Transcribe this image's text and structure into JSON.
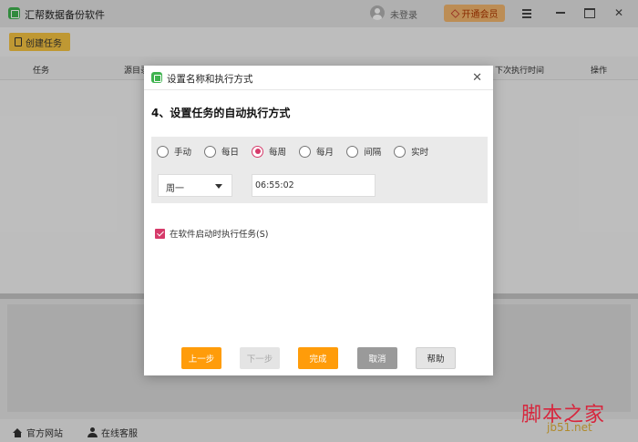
{
  "app": {
    "title": "汇帮数据备份软件",
    "login_label": "未登录",
    "vip_label": "开通会员"
  },
  "toolbar": {
    "create_task_label": "创建任务"
  },
  "table": {
    "headers": [
      "任务",
      "源目录",
      "下次执行时间",
      "操作"
    ]
  },
  "statusbar": {
    "website_label": "官方网站",
    "support_label": "在线客服"
  },
  "watermark": {
    "main": "脚本之家",
    "sub": "jb51.net"
  },
  "dialog": {
    "title": "设置名称和执行方式",
    "step_title": "4、设置任务的自动执行方式",
    "frequency_options": [
      {
        "label": "手动",
        "checked": false
      },
      {
        "label": "每日",
        "checked": false
      },
      {
        "label": "每周",
        "checked": true
      },
      {
        "label": "每月",
        "checked": false
      },
      {
        "label": "间隔",
        "checked": false
      },
      {
        "label": "实时",
        "checked": false
      }
    ],
    "weekday_value": "周一",
    "time_value": "06:55:02",
    "run_on_startup_label": "在软件启动时执行任务(S)",
    "run_on_startup_checked": true,
    "buttons": {
      "prev": "上一步",
      "next": "下一步",
      "finish": "完成",
      "cancel": "取消",
      "help": "帮助"
    }
  },
  "colors": {
    "accent_orange": "#ff9c0a",
    "radio_checked": "#d63a6a",
    "create_button": "#f5c342",
    "brand_green": "#3fb34f"
  }
}
